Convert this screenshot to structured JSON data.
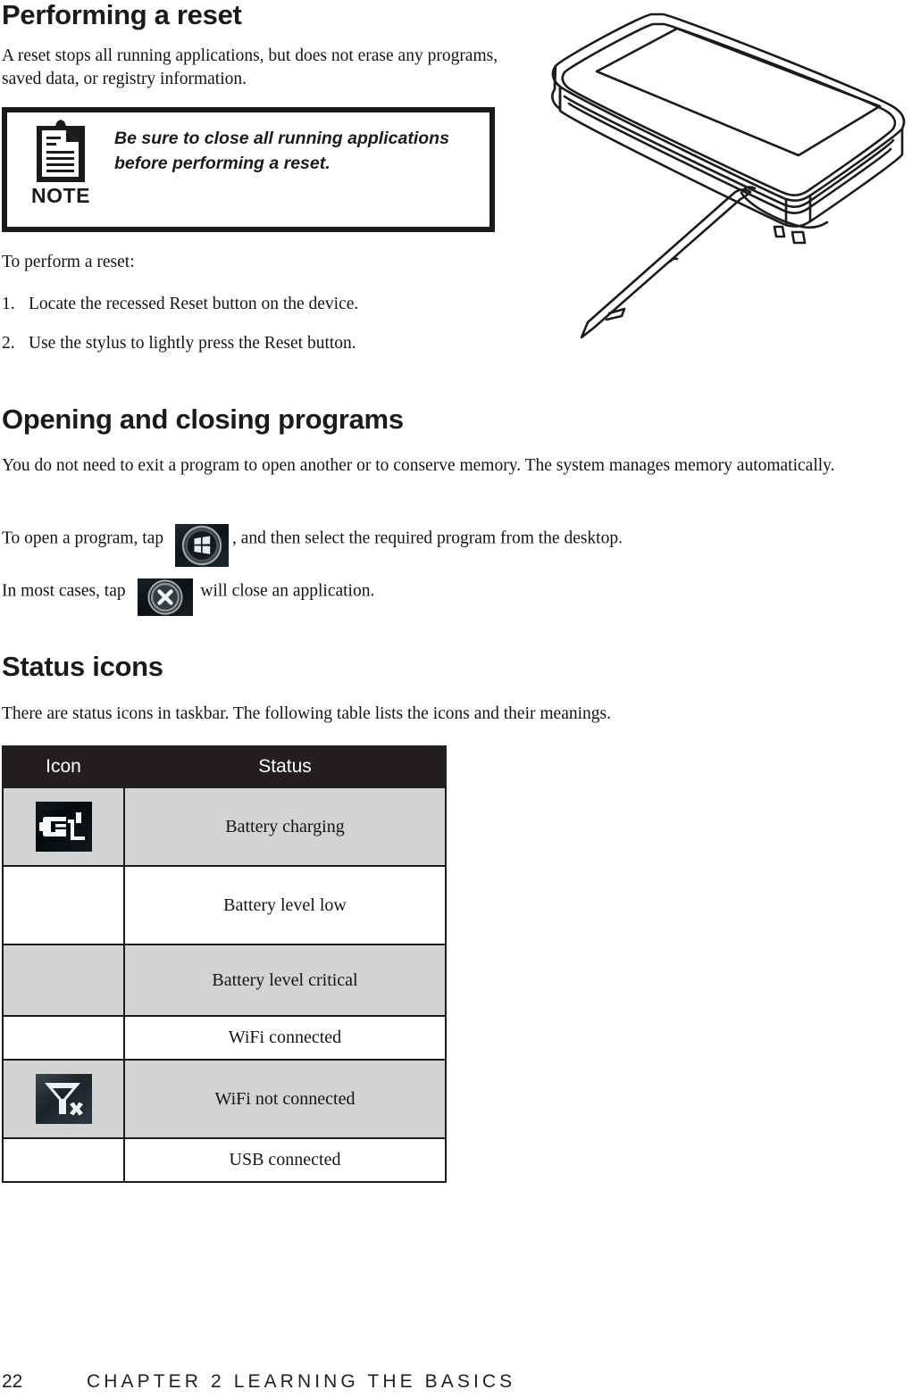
{
  "sections": {
    "reset": {
      "heading": "Performing a reset",
      "intro": "A reset stops all running applications, but does not erase any programs, saved data, or registry information.",
      "note": {
        "label": "NOTE",
        "text": "Be sure to close all running applications before performing a reset."
      },
      "lead_in": "To perform a reset:",
      "steps": [
        {
          "num": "1.",
          "text": "Locate the recessed Reset button on the device."
        },
        {
          "num": "2.",
          "text": "Use the stylus to lightly press the Reset button."
        }
      ]
    },
    "programs": {
      "heading": "Opening and closing programs",
      "paragraph": "You do not need to exit a program to open another or to conserve memory. The system manages memory automatically.",
      "open_before": "To open a program, tap",
      "open_after": ", and then select the required program from the desktop.",
      "close_before": "In most cases, tap",
      "close_after": "will close an application."
    },
    "status": {
      "heading": "Status icons",
      "paragraph": "There are status icons in taskbar. The following table lists the icons and their meanings."
    }
  },
  "table": {
    "headers": [
      "Icon",
      "Status"
    ],
    "rows": [
      {
        "icon": "battery-charging-icon",
        "has_icon": true,
        "status": "Battery charging"
      },
      {
        "icon": "battery-low-icon",
        "has_icon": false,
        "status": "Battery level low"
      },
      {
        "icon": "battery-critical-icon",
        "has_icon": false,
        "status": "Battery level critical"
      },
      {
        "icon": "wifi-connected-icon",
        "has_icon": false,
        "status": "WiFi connected"
      },
      {
        "icon": "wifi-disconnected-icon",
        "has_icon": true,
        "status": "WiFi not connected"
      },
      {
        "icon": "usb-connected-icon",
        "has_icon": false,
        "status": "USB connected"
      }
    ]
  },
  "footer": {
    "page_number": "22",
    "chapter": "CHAPTER 2 LEARNING THE BASICS"
  },
  "illustration": {
    "name": "pda-device-with-stylus"
  },
  "colors": {
    "text": "#141414",
    "heading": "#1b1b1b",
    "table_header_bg": "#231f1f",
    "table_row_shade": "#d2d3d5",
    "rule": "#1b1b1b"
  }
}
